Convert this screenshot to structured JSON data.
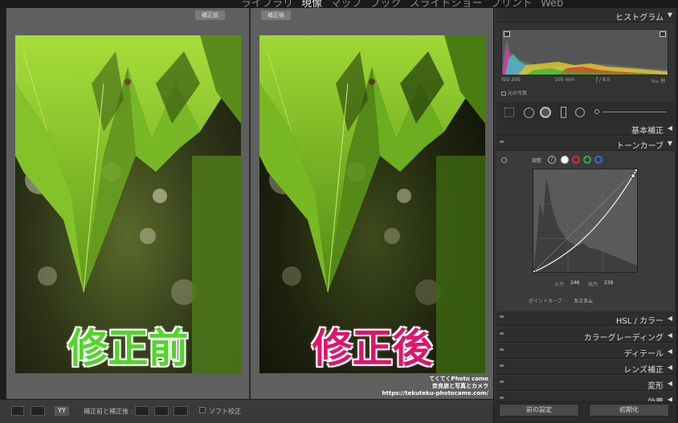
{
  "modules": {
    "items": [
      "ライブラリ",
      "現像",
      "マップ",
      "ブック",
      "スライドショー",
      "プリント",
      "Web"
    ],
    "active_index": 1
  },
  "compare": {
    "before_label": "補正前",
    "after_label": "補正後",
    "before_caption": "修正前",
    "after_caption": "修正後",
    "watermark": [
      "てくてくPhoto came",
      "奈良旅と写真とカメラ",
      "https://tekuteku-photocame.com/"
    ]
  },
  "toolbar": {
    "compare_label": "補正前と補正後 :",
    "soft_proof_label": "ソフト校正",
    "view_yy": "YY"
  },
  "right_panel": {
    "histogram_title": "ヒストグラム",
    "exif": {
      "iso": "ISO 200",
      "focal": "105 mm",
      "aperture": "ƒ / 8.0",
      "shutter": "⅟₂₅₀ 秒"
    },
    "original_photo_label": "元の写真",
    "sections": [
      {
        "label": "基本補正",
        "arrow": "◀"
      },
      {
        "label": "トーンカーブ",
        "arrow": "▼"
      },
      {
        "label": "HSL / カラー",
        "arrow": "◀"
      },
      {
        "label": "カラーグレーディング",
        "arrow": "◀"
      },
      {
        "label": "ディテール",
        "arrow": "◀"
      },
      {
        "label": "レンズ補正",
        "arrow": "◀"
      },
      {
        "label": "変形",
        "arrow": "◀"
      },
      {
        "label": "効果",
        "arrow": "◀"
      }
    ],
    "tone_curve": {
      "adjust_label": "調整",
      "input_label": "入力",
      "input_value": "246",
      "output_label": "出力",
      "output_value": "239",
      "point_curve_label": "ポイントカーブ :",
      "point_curve_value": "カスタム",
      "channel_colors": [
        "#ffffff",
        "#d83030",
        "#2fb33a",
        "#2f6fe0"
      ]
    },
    "buttons": {
      "previous": "前の設定",
      "reset": "初期化"
    }
  }
}
